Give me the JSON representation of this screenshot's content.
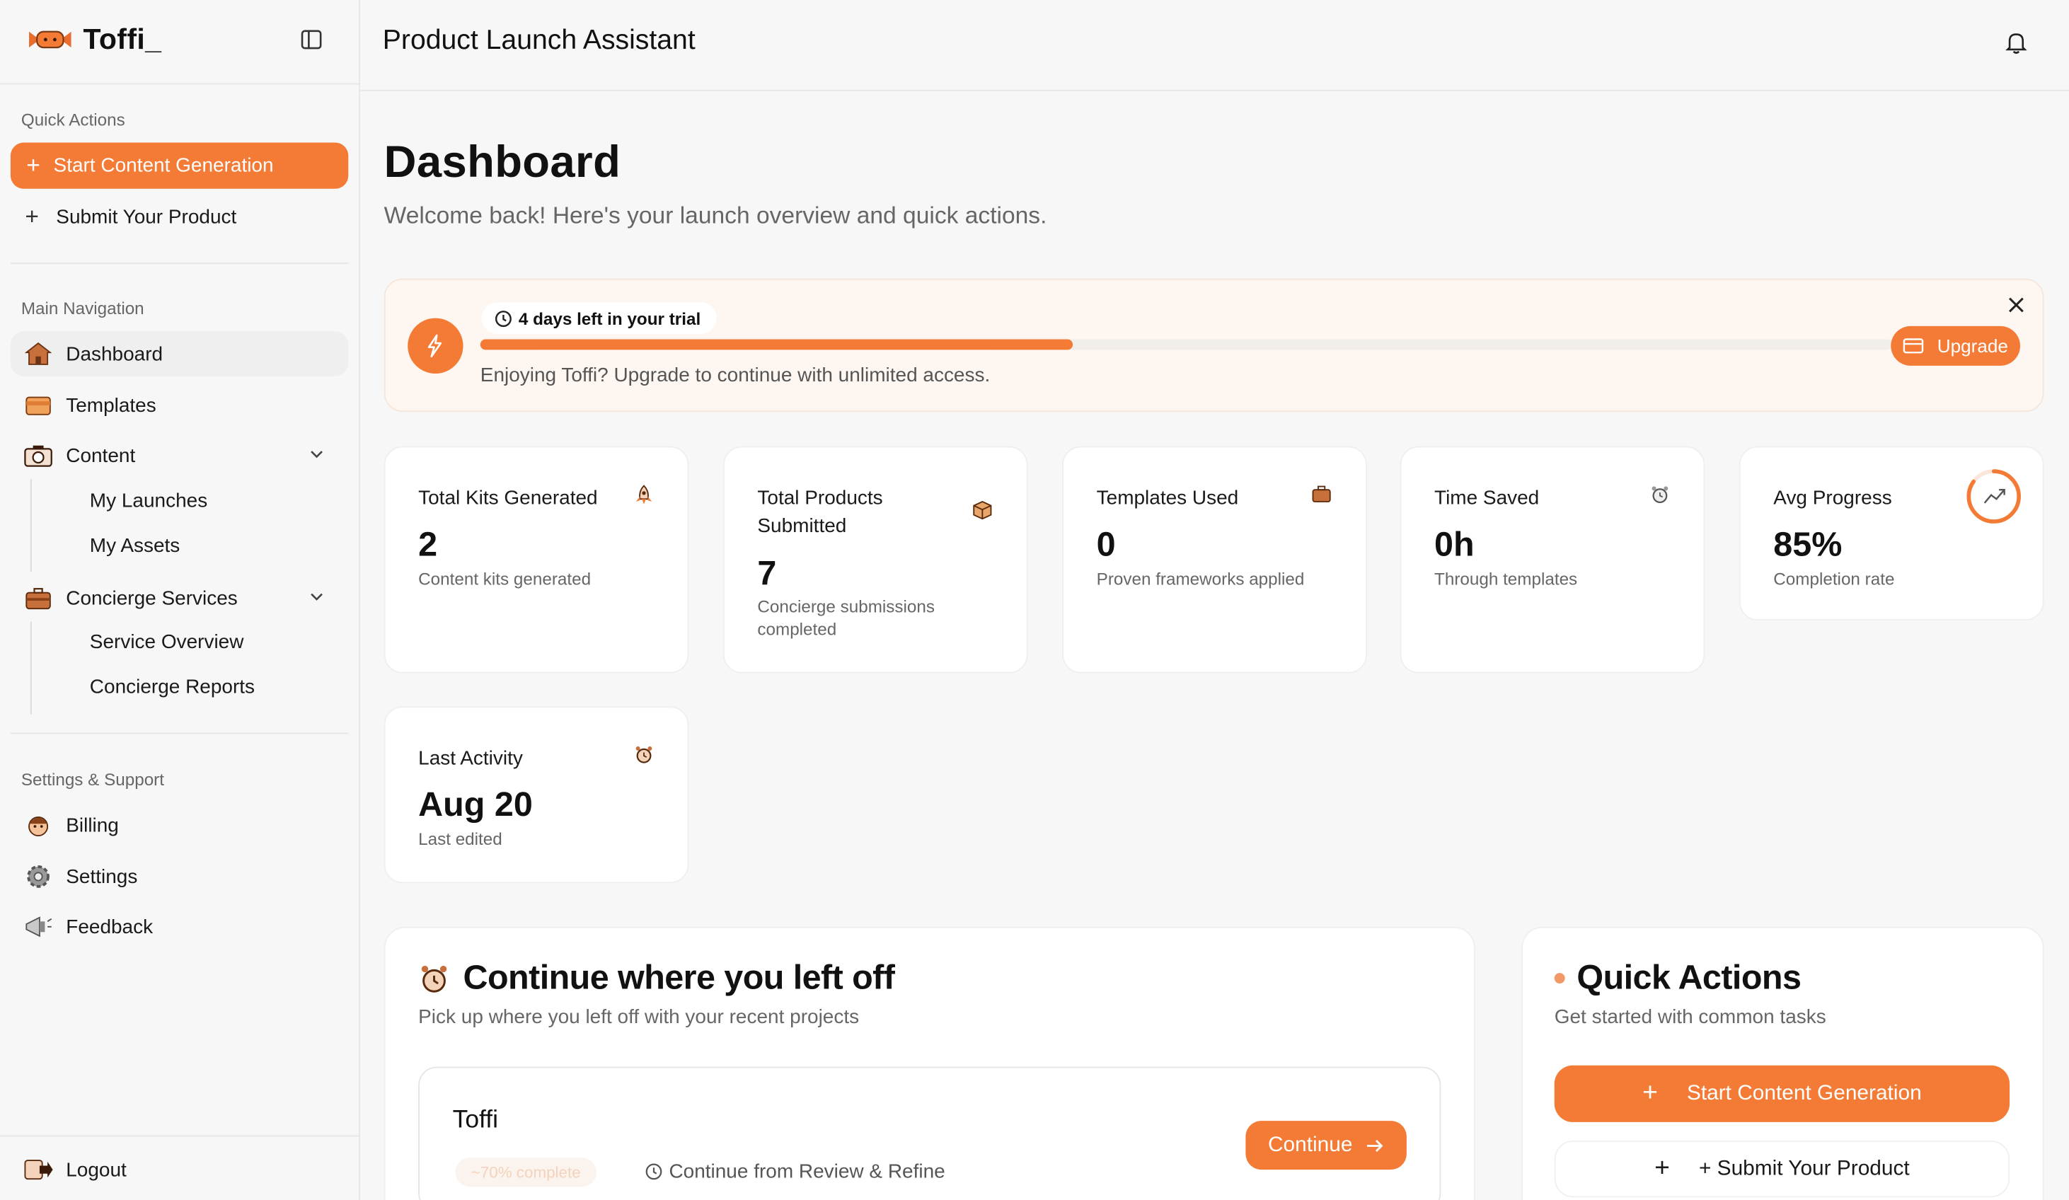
{
  "brand": {
    "name": "Toffi_"
  },
  "sidebar": {
    "quick_actions_label": "Quick Actions",
    "start_content_label": "Start Content Generation",
    "submit_product_label": "Submit Your Product",
    "main_nav_label": "Main Navigation",
    "dashboard": "Dashboard",
    "templates": "Templates",
    "content": "Content",
    "my_launches": "My Launches",
    "my_assets": "My Assets",
    "concierge": "Concierge Services",
    "service_overview": "Service Overview",
    "concierge_reports": "Concierge Reports",
    "settings_label": "Settings & Support",
    "billing": "Billing",
    "settings": "Settings",
    "feedback": "Feedback",
    "logout": "Logout"
  },
  "header": {
    "title": "Product Launch Assistant"
  },
  "page": {
    "title": "Dashboard",
    "subtitle": "Welcome back! Here's your launch overview and quick actions."
  },
  "trial": {
    "badge": "4 days left in your trial",
    "message": "Enjoying Toffi? Upgrade to continue with unlimited access.",
    "upgrade_label": "Upgrade",
    "progress": 0.42
  },
  "stats": [
    {
      "label": "Total Kits Generated",
      "value": "2",
      "desc": "Content kits generated"
    },
    {
      "label": "Total Products Submitted",
      "value": "7",
      "desc": "Concierge submissions completed"
    },
    {
      "label": "Templates Used",
      "value": "0",
      "desc": "Proven frameworks applied"
    },
    {
      "label": "Time Saved",
      "value": "0h",
      "desc": "Through templates"
    },
    {
      "label": "Avg Progress",
      "value": "85%",
      "desc": "Completion rate",
      "progress": 0.85
    },
    {
      "label": "Last Activity",
      "value": "Aug 20",
      "desc": "Last edited"
    }
  ],
  "continue_panel": {
    "title": "Continue where you left off",
    "subtitle": "Pick up where you left off with your recent projects",
    "project": {
      "name": "Toffi",
      "progress_text": "~70% complete",
      "continue_from": "Continue from Review & Refine",
      "button": "Continue"
    }
  },
  "quick_actions_panel": {
    "title": "Quick Actions",
    "subtitle": "Get started with common tasks",
    "primary": "Start Content Generation",
    "secondary": "+ Submit Your Product"
  },
  "colors": {
    "accent": "#f47b35",
    "accent_soft": "#fdf6f1"
  }
}
